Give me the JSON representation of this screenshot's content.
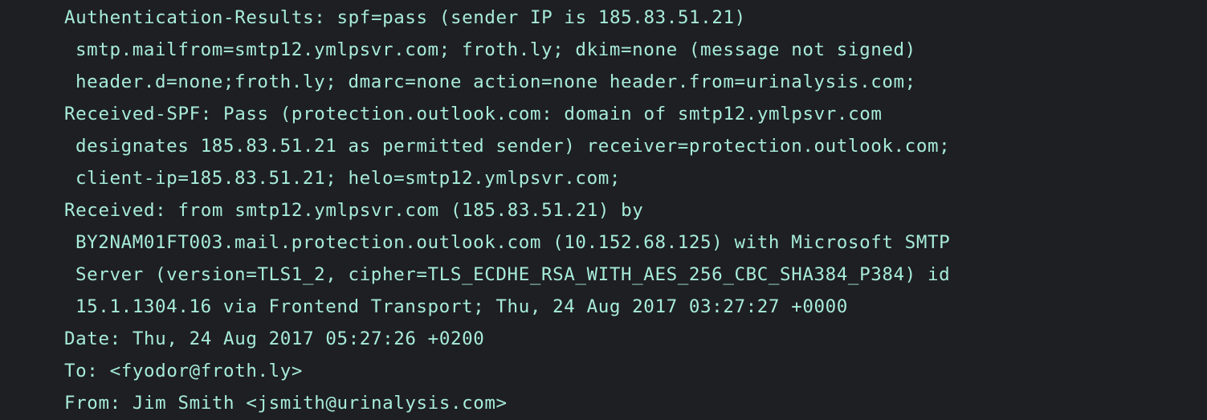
{
  "email_headers": {
    "lines": [
      {
        "text": "Authentication-Results: spf=pass (sender IP is 185.83.51.21)",
        "continuation": false
      },
      {
        "text": "smtp.mailfrom=smtp12.ymlpsvr.com; froth.ly; dkim=none (message not signed)",
        "continuation": true
      },
      {
        "text": "header.d=none;froth.ly; dmarc=none action=none header.from=urinalysis.com;",
        "continuation": true
      },
      {
        "text": "Received-SPF: Pass (protection.outlook.com: domain of smtp12.ymlpsvr.com",
        "continuation": false
      },
      {
        "text": "designates 185.83.51.21 as permitted sender) receiver=protection.outlook.com;",
        "continuation": true
      },
      {
        "text": "client-ip=185.83.51.21; helo=smtp12.ymlpsvr.com;",
        "continuation": true
      },
      {
        "text": "Received: from smtp12.ymlpsvr.com (185.83.51.21) by",
        "continuation": false
      },
      {
        "text": "BY2NAM01FT003.mail.protection.outlook.com (10.152.68.125) with Microsoft SMTP",
        "continuation": true
      },
      {
        "text": "Server (version=TLS1_2, cipher=TLS_ECDHE_RSA_WITH_AES_256_CBC_SHA384_P384) id",
        "continuation": true
      },
      {
        "text": "15.1.1304.16 via Frontend Transport; Thu, 24 Aug 2017 03:27:27 +0000",
        "continuation": true
      },
      {
        "text": "Date: Thu, 24 Aug 2017 05:27:26 +0200",
        "continuation": false
      },
      {
        "text": "To: <fyodor@froth.ly>",
        "continuation": false
      },
      {
        "text": "From: Jim Smith <jsmith@urinalysis.com>",
        "continuation": false
      }
    ]
  },
  "colors": {
    "background": "#1e1f22",
    "text": "#a7ecd9"
  }
}
